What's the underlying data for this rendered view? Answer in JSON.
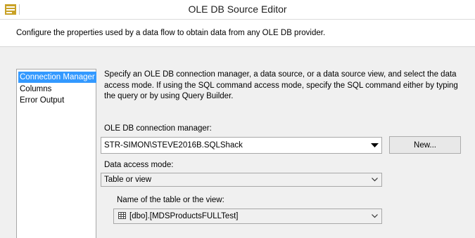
{
  "window": {
    "title": "OLE DB Source Editor"
  },
  "header": {
    "description": "Configure the properties used by a data flow to obtain data from any OLE DB provider."
  },
  "nav": {
    "items": [
      {
        "label": "Connection Manager",
        "selected": true
      },
      {
        "label": "Columns",
        "selected": false
      },
      {
        "label": "Error Output",
        "selected": false
      }
    ]
  },
  "main": {
    "description": "Specify an OLE DB connection manager, a data source, or a data source view, and select the data access mode. If using the SQL command access mode, specify the SQL command either by typing the query or by using Query Builder.",
    "connection_label": "OLE DB connection manager:",
    "connection_value": "STR-SIMON\\STEVE2016B.SQLShack",
    "new_button": "New...",
    "access_mode_label": "Data access mode:",
    "access_mode_value": "Table or view",
    "table_label": "Name of the table or the view:",
    "table_value": "[dbo].[MDSProductsFULLTest]"
  }
}
